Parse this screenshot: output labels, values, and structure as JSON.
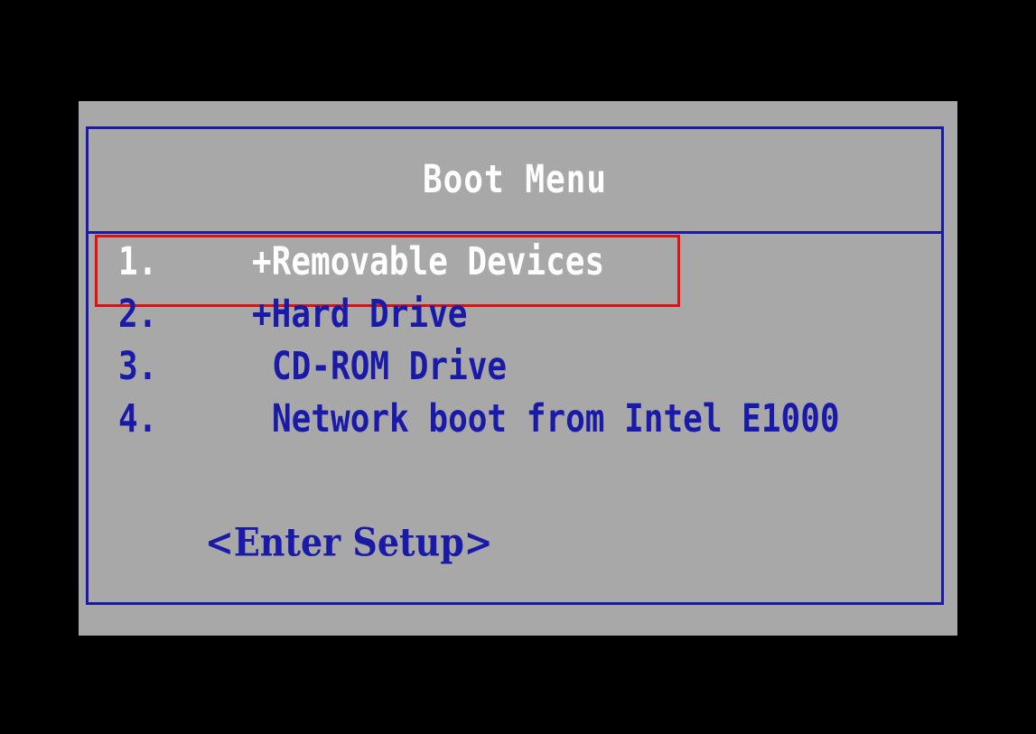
{
  "boot_menu": {
    "title": "Boot Menu",
    "items": [
      {
        "number": "1.",
        "label": "+Removable Devices",
        "selected": true
      },
      {
        "number": "2.",
        "label": "+Hard Drive",
        "selected": false
      },
      {
        "number": "3.",
        "label": "CD-ROM Drive",
        "selected": false
      },
      {
        "number": "4.",
        "label": "Network boot from Intel E1000",
        "selected": false
      }
    ],
    "setup_label": "<Enter Setup>"
  },
  "colors": {
    "screen_background": "#000000",
    "panel_background": "#a8a8a8",
    "text_blue": "#1a1aa8",
    "selected_text": "#ffffff",
    "highlight_border": "#e01010"
  }
}
